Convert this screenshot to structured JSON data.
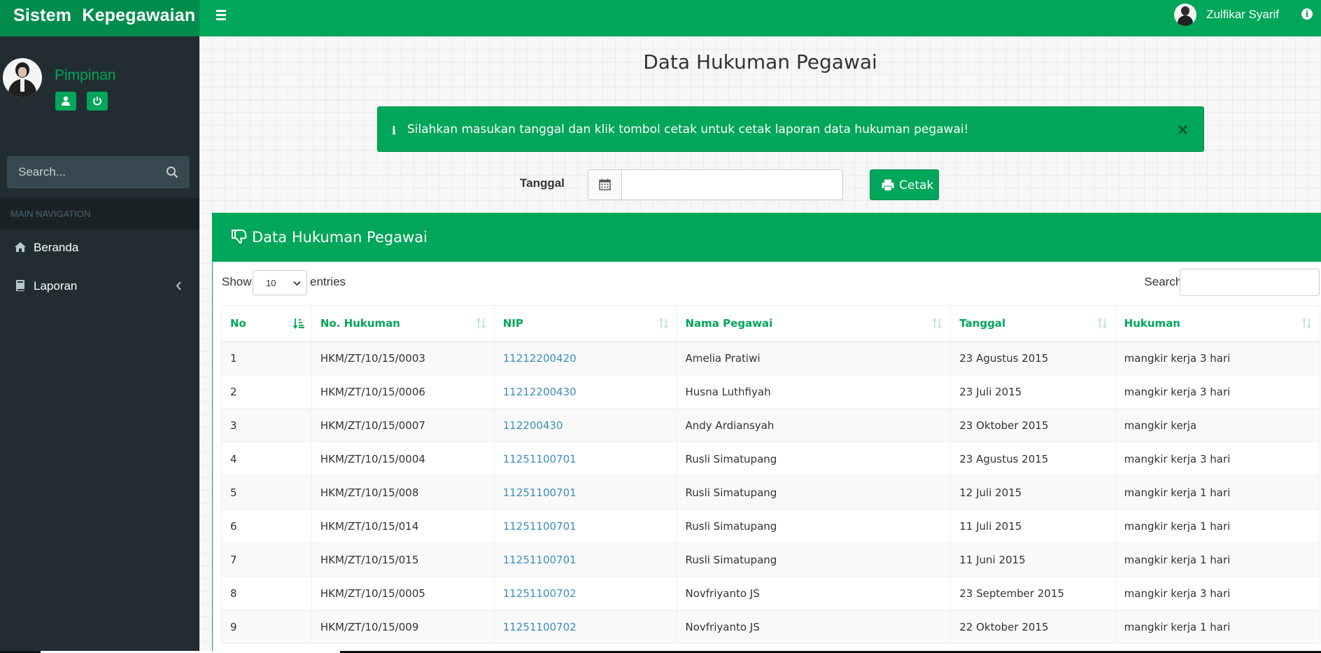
{
  "app": {
    "title": "Sistem Kepegawaian"
  },
  "header": {
    "user_name": "Zulfikar Syarif",
    "menu_icon": "bars-icon",
    "info_icon": "info-icon"
  },
  "sidebar": {
    "role": "Pimpinan",
    "search_placeholder": "Search...",
    "nav_header": "MAIN NAVIGATION",
    "items": [
      {
        "label": "Beranda",
        "icon": "home-icon"
      },
      {
        "label": "Laporan",
        "icon": "book-icon"
      }
    ]
  },
  "page": {
    "title": "Data Hukuman Pegawai",
    "alert": "Silahkan masukan tanggal dan klik tombol cetak untuk cetak laporan data hukuman pegawai!",
    "date_label": "Tanggal",
    "date_value": "",
    "print_button": "Cetak"
  },
  "box": {
    "title": "Data Hukuman Pegawai"
  },
  "datatable": {
    "show_label": "Show",
    "length_value": "10",
    "entries_label": "entries",
    "search_label": "Search:",
    "search_value": "",
    "columns": [
      "No",
      "No. Hukuman",
      "NIP",
      "Nama Pegawai",
      "Tanggal",
      "Hukuman"
    ],
    "rows": [
      [
        "1",
        "HKM/ZT/10/15/0003",
        "11212200420",
        "Amelia Pratiwi",
        "23 Agustus 2015",
        "mangkir kerja 3 hari"
      ],
      [
        "2",
        "HKM/ZT/10/15/0006",
        "11212200430",
        "Husna Luthfiyah",
        "23 Juli 2015",
        "mangkir kerja 3 hari"
      ],
      [
        "3",
        "HKM/ZT/10/15/0007",
        "112200430",
        "Andy Ardiansyah",
        "23 Oktober 2015",
        "mangkir kerja"
      ],
      [
        "4",
        "HKM/ZT/10/15/0004",
        "11251100701",
        "Rusli Simatupang",
        "23 Agustus 2015",
        "mangkir kerja 3 hari"
      ],
      [
        "5",
        "HKM/ZT/10/15/008",
        "11251100701",
        "Rusli Simatupang",
        "12 Juli 2015",
        "mangkir kerja 1 hari"
      ],
      [
        "6",
        "HKM/ZT/10/15/014",
        "11251100701",
        "Rusli Simatupang",
        "11 Juli 2015",
        "mangkir kerja 1 hari"
      ],
      [
        "7",
        "HKM/ZT/10/15/015",
        "11251100701",
        "Rusli Simatupang",
        "11 Juni 2015",
        "mangkir kerja 1 hari"
      ],
      [
        "8",
        "HKM/ZT/10/15/0005",
        "11251100702",
        "Novfriyanto JS",
        "23 September 2015",
        "mangkir kerja 3 hari"
      ],
      [
        "9",
        "HKM/ZT/10/15/009",
        "11251100702",
        "Novfriyanto JS",
        "22 Oktober 2015",
        "mangkir kerja 1 hari"
      ]
    ]
  },
  "colors": {
    "primary": "#00a65a",
    "primary_dark": "#008d4c",
    "sidebar": "#222d32",
    "link": "#3c8dbc"
  }
}
